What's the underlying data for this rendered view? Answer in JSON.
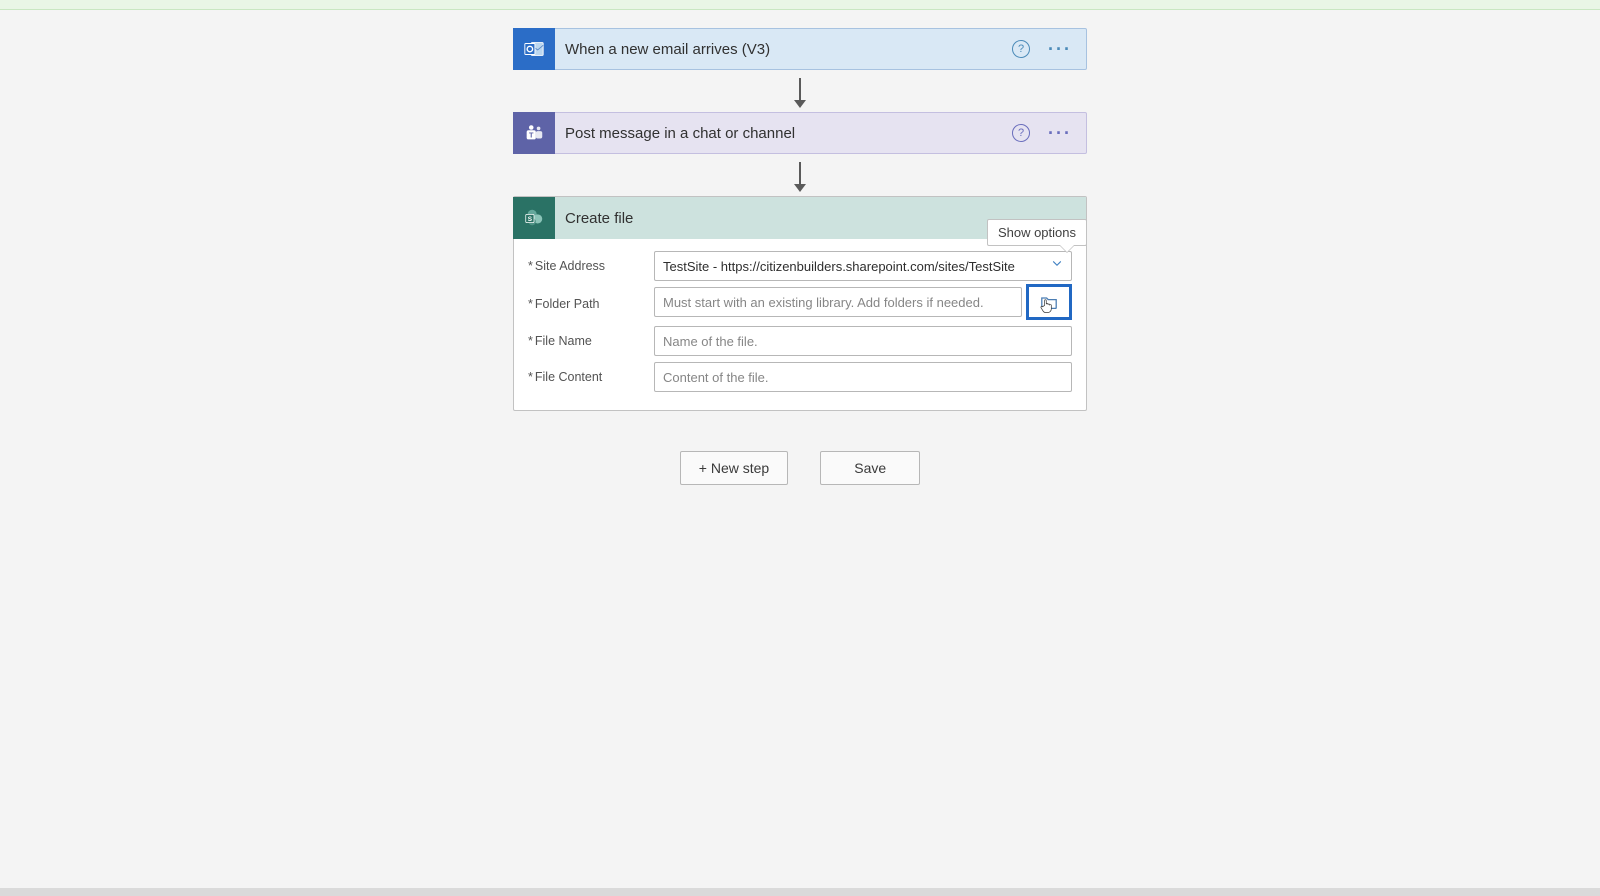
{
  "triggers": {
    "outlook": {
      "title": "When a new email arrives (V3)"
    },
    "teams": {
      "title": "Post message in a chat or channel"
    },
    "sharepoint": {
      "title": "Create file",
      "show_options": "Show options",
      "fields": {
        "site_address": {
          "label": "Site Address",
          "value": "TestSite - https://citizenbuilders.sharepoint.com/sites/TestSite"
        },
        "folder_path": {
          "label": "Folder Path",
          "placeholder": "Must start with an existing library. Add folders if needed."
        },
        "file_name": {
          "label": "File Name",
          "placeholder": "Name of the file."
        },
        "file_content": {
          "label": "File Content",
          "placeholder": "Content of the file."
        }
      }
    }
  },
  "buttons": {
    "new_step": "+ New step",
    "save": "Save"
  },
  "required_marker": "*"
}
